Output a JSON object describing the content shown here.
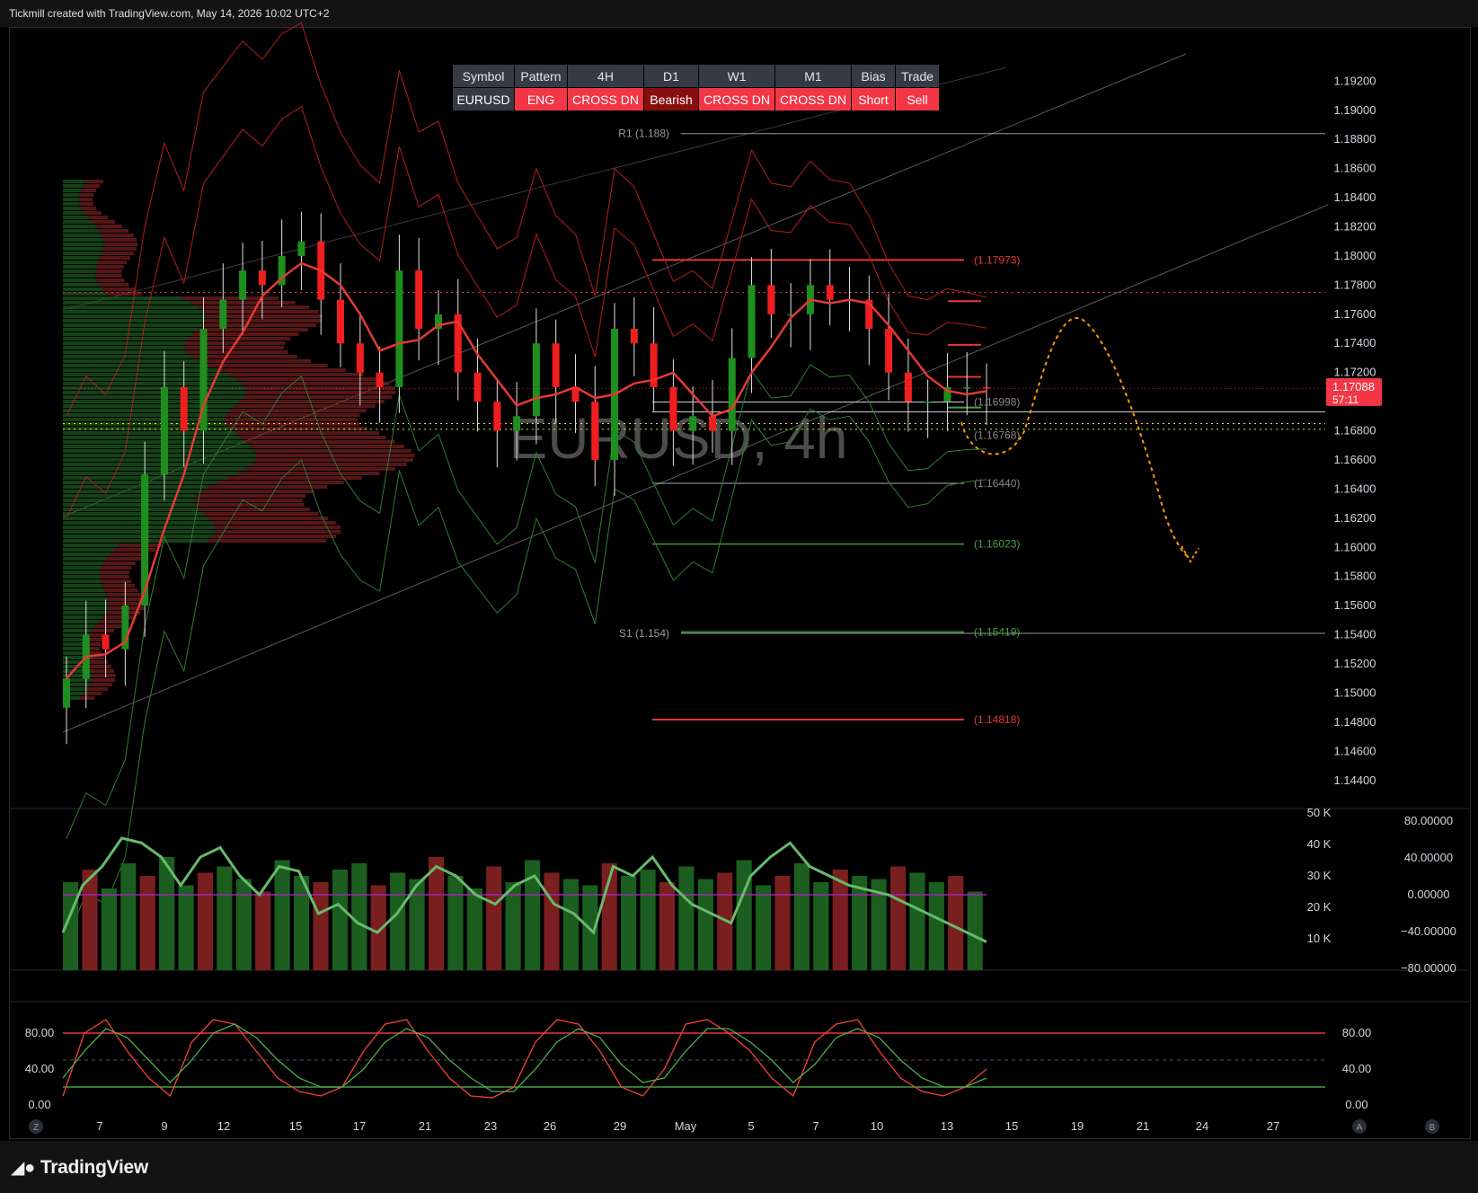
{
  "header": {
    "title": "Tickmill created with TradingView.com, May 14, 2026 10:02 UTC+2"
  },
  "footer": {
    "brand": "TradingView"
  },
  "info_table": {
    "headers": [
      "Symbol",
      "Pattern",
      "4H",
      "D1",
      "W1",
      "M1",
      "Bias",
      "Trade"
    ],
    "values": [
      "EURUSD",
      "ENG",
      "CROSS DN",
      "Bearish",
      "CROSS DN",
      "CROSS DN",
      "Short",
      "Sell"
    ],
    "colors": {
      "neutral": "#363a45",
      "bearish": "#f23645",
      "dark_bearish": "#880e0e"
    }
  },
  "watermark": "EURUSD, 4h",
  "chart_data": [
    {
      "type": "candlestick",
      "symbol": "EURUSD",
      "timeframe": "4h",
      "price_axis_labels": [
        "1.19200",
        "1.19000",
        "1.18800",
        "1.18600",
        "1.18400",
        "1.18200",
        "1.18000",
        "1.17800",
        "1.17600",
        "1.17400",
        "1.17200",
        "1.16800",
        "1.16600",
        "1.16400",
        "1.16200",
        "1.16000",
        "1.15800",
        "1.15600",
        "1.15400",
        "1.15200",
        "1.15000",
        "1.14800",
        "1.14600",
        "1.14400"
      ],
      "ylim": [
        1.143,
        1.1935
      ],
      "current_price": "1.17088",
      "countdown": "57:11",
      "x_ticks": [
        "7",
        "9",
        "12",
        "15",
        "17",
        "21",
        "23",
        "26",
        "29",
        "May",
        "5",
        "7",
        "10",
        "13",
        "15",
        "19",
        "21",
        "24",
        "27"
      ],
      "levels": [
        {
          "label": "R1 (1.188)",
          "value": 1.1884
        },
        {
          "label": "(1.17973)",
          "value": 1.17973
        },
        {
          "label": "(1.16998)",
          "value": 1.16998
        },
        {
          "label": "(1.16768)",
          "value": 1.16768
        },
        {
          "label": "(1.16440)",
          "value": 1.1644
        },
        {
          "label": "(1.16023)",
          "value": 1.16023
        },
        {
          "label": "S1 (1.154)",
          "value": 1.1541
        },
        {
          "label": "(1.15419)",
          "value": 1.15419
        },
        {
          "label": "(1.14818)",
          "value": 1.14818
        }
      ],
      "closes": [
        1.151,
        1.154,
        1.153,
        1.156,
        1.165,
        1.171,
        1.168,
        1.175,
        1.177,
        1.179,
        1.178,
        1.18,
        1.181,
        1.177,
        1.174,
        1.172,
        1.171,
        1.179,
        1.175,
        1.176,
        1.172,
        1.17,
        1.168,
        1.169,
        1.174,
        1.171,
        1.17,
        1.166,
        1.175,
        1.174,
        1.171,
        1.168,
        1.169,
        1.168,
        1.173,
        1.178,
        1.176,
        1.176,
        1.178,
        1.177,
        1.177,
        1.175,
        1.172,
        1.17,
        1.17,
        1.171,
        1.171,
        1.1709
      ],
      "colors": {
        "up": "#1e8f1e",
        "down": "#f01e1e"
      }
    },
    {
      "type": "bar",
      "name": "volume",
      "axis_labels": [
        "50 K",
        "40 K",
        "30 K",
        "20 K",
        "10 K"
      ],
      "osc_axis_labels": [
        "80.00000",
        "40.00000",
        "0.00000",
        "−40.00000",
        "−80.00000"
      ],
      "values": [
        28,
        32,
        26,
        34,
        30,
        36,
        27,
        31,
        33,
        29,
        25,
        35,
        30,
        28,
        32,
        34,
        27,
        31,
        29,
        36,
        30,
        26,
        33,
        28,
        35,
        31,
        29,
        27,
        34,
        30,
        32,
        28,
        33,
        29,
        31,
        35,
        27,
        30,
        34,
        28,
        32,
        30,
        29,
        33,
        31,
        28,
        30,
        25
      ],
      "osc": [
        -40,
        10,
        30,
        60,
        55,
        40,
        10,
        40,
        50,
        20,
        0,
        30,
        25,
        -20,
        -10,
        -30,
        -40,
        -20,
        10,
        30,
        20,
        0,
        -10,
        10,
        20,
        -10,
        -20,
        -40,
        30,
        20,
        40,
        10,
        -10,
        -20,
        -30,
        20,
        40,
        55,
        30,
        20,
        10,
        5,
        0,
        -10,
        -20,
        -30,
        -40,
        -50
      ]
    },
    {
      "type": "line",
      "name": "stochastic",
      "axis_labels": [
        "80.00",
        "40.00",
        "0.00"
      ],
      "ylim": [
        0,
        100
      ],
      "k": [
        10,
        80,
        95,
        60,
        30,
        10,
        70,
        95,
        90,
        60,
        30,
        15,
        10,
        20,
        60,
        90,
        95,
        60,
        30,
        10,
        8,
        20,
        70,
        95,
        90,
        60,
        20,
        10,
        40,
        90,
        95,
        80,
        60,
        30,
        10,
        70,
        90,
        95,
        60,
        30,
        15,
        10,
        20,
        40
      ],
      "d": [
        30,
        60,
        85,
        75,
        50,
        25,
        50,
        80,
        90,
        75,
        50,
        30,
        20,
        20,
        40,
        70,
        85,
        75,
        50,
        30,
        15,
        15,
        40,
        70,
        85,
        75,
        45,
        25,
        30,
        60,
        85,
        85,
        70,
        50,
        25,
        45,
        75,
        85,
        75,
        50,
        30,
        20,
        20,
        30
      ]
    }
  ],
  "axis_buttons": {
    "left": "Z",
    "right1": "A",
    "right2": "B"
  }
}
